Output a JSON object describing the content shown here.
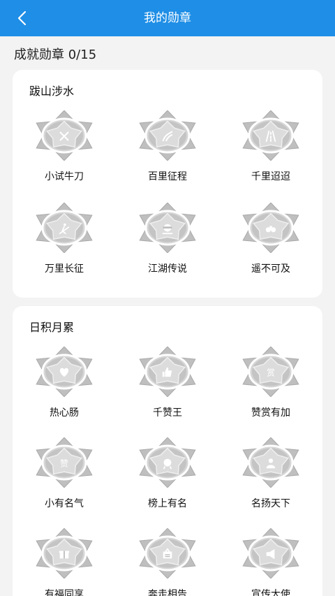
{
  "header": {
    "title": "我的勋章",
    "back_icon": "chevron-left-icon"
  },
  "summary": {
    "label": "成就勋章 0/15"
  },
  "sections": [
    {
      "title": "跋山涉水",
      "badges": [
        {
          "name": "小试牛刀",
          "icon": "crossed-swords-icon"
        },
        {
          "name": "百里征程",
          "icon": "road-curve-icon"
        },
        {
          "name": "千里迢迢",
          "icon": "highway-icon"
        },
        {
          "name": "万里长征",
          "icon": "climber-icon"
        },
        {
          "name": "江湖传说",
          "icon": "masked-hero-icon"
        },
        {
          "name": "遥不可及",
          "icon": "binoculars-icon"
        }
      ]
    },
    {
      "title": "日积月累",
      "badges": [
        {
          "name": "热心肠",
          "icon": "heart-icon"
        },
        {
          "name": "千赞王",
          "icon": "thumbs-up-icon"
        },
        {
          "name": "赞赏有加",
          "icon": "reward-icon"
        },
        {
          "name": "小有名气",
          "icon": "popularity-icon"
        },
        {
          "name": "榜上有名",
          "icon": "ranking-badge-icon"
        },
        {
          "name": "名扬天下",
          "icon": "person-icon"
        },
        {
          "name": "有福同享",
          "icon": "gift-icon"
        },
        {
          "name": "奔走相告",
          "icon": "share-icon"
        },
        {
          "name": "宣传大使",
          "icon": "megaphone-icon"
        }
      ]
    }
  ],
  "colors": {
    "header": "#1e8ee6",
    "background": "#f3f3f3",
    "card": "#ffffff",
    "medal_silver": "#c9c9c9"
  }
}
